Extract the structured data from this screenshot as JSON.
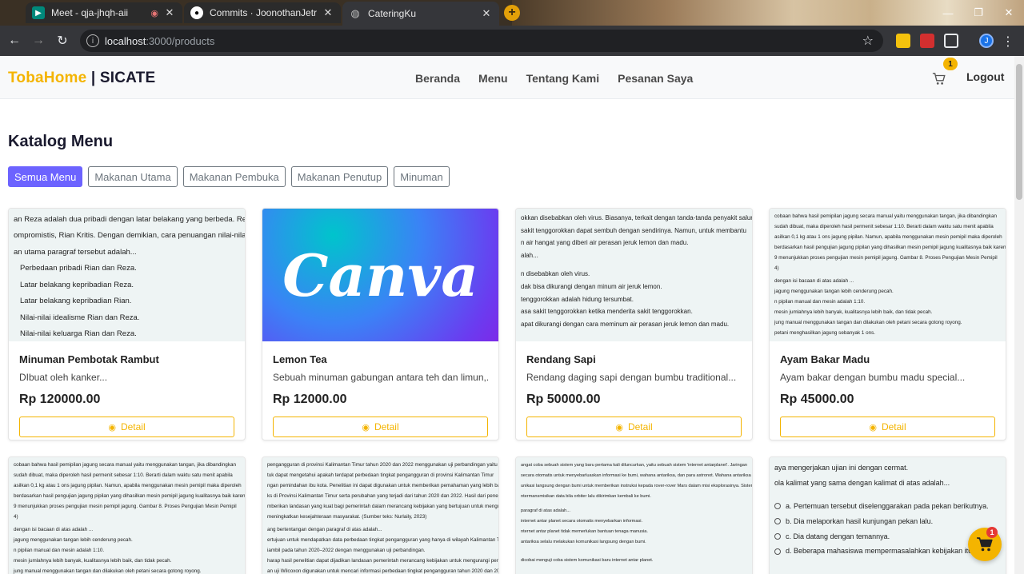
{
  "browser": {
    "tabs": [
      {
        "title": "Meet - qja-jhqh-aii",
        "icon": "meet-icon",
        "active": false
      },
      {
        "title": "Commits · JoonothanJetr/Tube",
        "icon": "github-icon",
        "active": false
      },
      {
        "title": "CateringKu",
        "icon": "globe-icon",
        "active": true
      }
    ],
    "url_host": "localhost",
    "url_path": ":3000/products",
    "profile_initial": "J"
  },
  "navbar": {
    "brand_accent": "TobaHome",
    "brand_rest": " | SICATE",
    "links": [
      "Beranda",
      "Menu",
      "Tentang Kami",
      "Pesanan Saya"
    ],
    "cart_count": "1",
    "logout": "Logout"
  },
  "catalog": {
    "title": "Katalog Menu",
    "filters": [
      "Semua Menu",
      "Makanan Utama",
      "Makanan Pembuka",
      "Makanan Penutup",
      "Minuman"
    ],
    "active_filter": "Semua Menu"
  },
  "products": [
    {
      "name": "Minuman Pembotak Rambut",
      "desc": "DIbuat oleh kanker...",
      "price": "Rp 120000.00",
      "detail": "Detail"
    },
    {
      "name": "Lemon Tea",
      "desc": "Sebuah minuman gabungan antara teh dan limun,...",
      "price": "Rp 12000.00",
      "detail": "Detail"
    },
    {
      "name": "Rendang Sapi",
      "desc": "Rendang daging sapi dengan bumbu traditional...",
      "price": "Rp 50000.00",
      "detail": "Detail"
    },
    {
      "name": "Ayam Bakar Madu",
      "desc": "Ayam bakar dengan bumbu madu special...",
      "price": "Rp 45000.00",
      "detail": "Detail"
    }
  ],
  "thumbs": {
    "card1": [
      "an Reza adalah dua pribadi dengan latar belakang yang berbeda. Reza adalah",
      "ompromistis, Rian Kritis. Dengan demikian, cara penuangan nilai-nilai idealisme",
      "an utama paragraf tersebut adalah...",
      "Perbedaan pribadi Rian dan Reza.",
      "Latar belakang kepribadian Reza.",
      "Latar belakang kepribadian Rian.",
      "Nilai-nilai idealisme Rian dan Reza.",
      "Nilai-nilai keluarga Rian dan Reza."
    ],
    "card2_logo": "Canva",
    "card3": [
      "okkan disebabkan oleh virus. Biasanya, terkait dengan tanda-tanda penyakit saluran napas",
      "sakit tenggorokkan dapat sembuh dengan sendirinya. Namun, untuk membantu",
      "n air hangat yang diberi air perasan jeruk lemon dan madu.",
      "alah...",
      "n disebabkan oleh virus.",
      "dak bisa dikurangi dengan minum air jeruk lemon.",
      "tenggorokkan adalah hidung tersumbat.",
      "asa sakit tenggorokkan ketika menderita sakit tenggorokkan.",
      "apat dikurangi dengan cara meminum air perasan jeruk lemon dan madu."
    ],
    "card4": [
      "cobaan bahwa hasil pemipilan jagung secara manual yaitu menggunakan tangan, jika dibandingkan",
      "sudah dibuat, maka diperoleh hasil permenit sebesar 1:10. Berarti dalam waktu satu menit apabila",
      "asilkan 0,1 kg atau 1 ons jagung pipilan. Namun, apabila menggunakan mesin pemipil maka diperoleh",
      "berdasarkan hasil pengujian jagung pipilan yang dihasilkan mesin pemipil jagung kualitasnya baik karena",
      "9 menunjukkan proses pengujian mesin pemipil jagung. Gambar 8. Proses Pengujian Mesin Pemipil",
      "4)",
      "dengan isi bacaan di atas adalah ...",
      "jagung menggunakan tangan lebih cenderung pecah.",
      "n pipilan manual dan mesin adalah 1:10.",
      "mesin jumlahnya lebih banyak, kualitasnya lebih baik, dan tidak pecah.",
      "jung manual menggunakan tangan dan dilakukan oleh petani secara gotong royong.",
      "petani menghasilkan jagung sebanyak 1 ons."
    ],
    "card5": [
      "cobaan bahwa hasil pemipilan jagung secara manual yaitu menggunakan tangan, jika dibandingkan",
      "sudah dibuat, maka diperoleh hasil permenit sebesar 1:10. Berarti dalam waktu satu menit apabila",
      "asilkan 0,1 kg atau 1 ons jagung pipilan. Namun, apabila menggunakan mesin pemipil maka diperoleh",
      "berdasarkan hasil pengujian jagung pipilan yang dihasilkan mesin pemipil jagung kualitasnya baik karena",
      "9 menunjukkan proses pengujian mesin pemipil jagung. Gambar 8. Proses Pengujian Mesin Pemipil",
      "4)",
      "dengan isi bacaan di atas adalah ...",
      "jagung menggunakan tangan lebih cenderung pecah.",
      "n pipilan manual dan mesin adalah 1:10.",
      "mesin jumlahnya lebih banyak, kualitasnya lebih baik, dan tidak pecah.",
      "jung manual menggunakan tangan dan dilakukan oleh petani secara gotong royong."
    ],
    "card6": [
      "pengangguran di provinsi Kalimantan Timur tahun 2020 dan 2022 menggunakan uji perbandingan yaitu",
      "tuk dapat mengetahui apakah terdapat perbedaan tingkat pengangguran di provinsi Kalimantan Timur",
      "ngan pemindahan ibu kota. Penelitian ini dapat digunakan untuk memberikan pemahaman yang lebih baik",
      "ks di Provinsi Kalimantan Timur serta perubahan yang terjadi dari tahun 2020 dan 2022. Hasil dari penelitian",
      "mberikan landasan yang kuat bagi pemerintah dalam merancang kebijakan yang bertujuan untuk mengurangi",
      "meningkatkan kesejahteraan masyarakat. (Sumber teks: Nurlaily, 2023)",
      "ang bertentangan dengan paragraf di atas adalah...",
      "ertujuan untuk mendapatkan data perbedaan tingkat pengangguran yang hanya di wilayah Kalimantan Timur.",
      "iambil pada tahun 2020–2022 dengan menggunakan uji perbandingan.",
      "harap hasil penelitian dapat dijadikan landasan pemerintah merancang kebijakan untuk mengurangi pengangguran",
      "an uji Wilcoxon digunakan untuk mencari informasi perbedaan tingkat pengangguran tahun 2020 dan 2022."
    ],
    "card7": [
      "angat coba sebuah sistem yang baru pertama kali diluncurkan, yaitu sebuah sistem 'internet antarplanet'. Jaringan",
      "secara otomatis untuk menyebarluaskan informasi ke bumi, wahana antariksa, dan para astronot. Wahana antariksa",
      "unikasi langsung dengan bumi untuk memberikan instruksi kepada rover-rover Mars dalam misi eksplorasinya. Sistem",
      "ntermansmisikan data bila orbiter lalu dikirimkan kembali ke bumi.",
      "paragraf di atas adalah...",
      "internet antar planet secara otomatis menyebarkan informasi.",
      "nternet antar planet tidak memerlukan bantuan tenaga manusia.",
      "antariksa selalu melakukan komunikasi langsung dengan bumi.",
      "dicobai menguji coba sistem komunikasi baru internet antar planet."
    ],
    "card8_lines": [
      "aya mengerjakan ujian ini dengan cermat.",
      "ola kalimat yang sama dengan kalimat di atas adalah..."
    ],
    "card8_options": [
      "a.   Pertemuan tersebut diselenggarakan pada pekan berikutnya.",
      "b.   Dia melaporkan hasil kunjungan pekan lalu.",
      "c.   Dia datang dengan temannya.",
      "d.   Beberapa mahasiswa mempermasalahkan kebijakan itu."
    ]
  },
  "floating_cart_count": "1",
  "colors": {
    "accent": "#f4b400",
    "primary": "#6c63ff",
    "text": "#1a1a2e"
  }
}
